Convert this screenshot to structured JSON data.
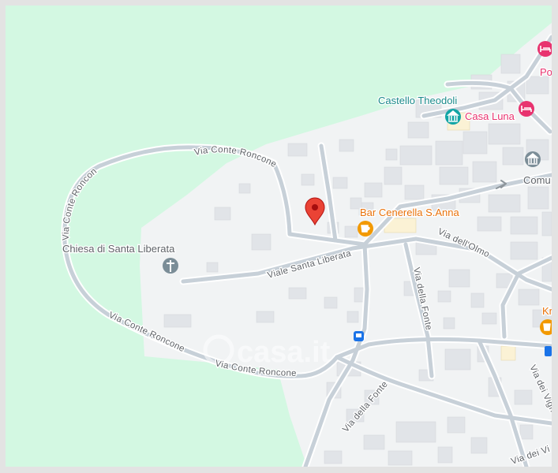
{
  "map": {
    "colors": {
      "park": "#d3f8e2",
      "land": "#f1f3f4",
      "road": "#c7d0d8",
      "road_edge": "#ffffff",
      "building": "#e1e4e8",
      "road_label": "#5f6368",
      "poi_dark": "#5f6368",
      "poi_teal": "#1a8a8a",
      "poi_orange": "#e8710a",
      "poi_pink": "#e8336f",
      "pin": "#ea4335",
      "transit": "#1a73e8"
    },
    "streets": {
      "via_conte_roncone_top": "Via Conte Roncone",
      "via_conte_roncone_left": "Via Conte Roncone",
      "via_conte_roncone_bottom_a": "Via Conte Roncone",
      "via_conte_roncone_bottom_b": "Via Conte Roncone",
      "viale_santa_liberata": "Viale Santa Liberata",
      "via_dell_olmo": "Via dell'Olmo",
      "via_della_fonte_north": "Via della Fonte",
      "via_della_fonte_south": "Via della Fonte",
      "via_dei_vigneti_a": "Via dei Vign",
      "via_dei_vigneti_b": "Via dei Vi"
    },
    "pois": {
      "castello": "Castello Theodoli",
      "casa_luna": "Casa Luna",
      "chiesa": "Chiesa di Santa Liberata",
      "bar": "Bar Cenerella S.Anna",
      "comune": "Comu",
      "po": "Po",
      "kr": "Kr"
    },
    "watermark": "casa.it",
    "icons": {
      "pin": "location-pin-icon",
      "church": "church-icon",
      "cafe": "cafe-icon",
      "hotel": "hotel-icon",
      "museum": "museum-icon",
      "bus": "bus-stop-icon"
    }
  }
}
